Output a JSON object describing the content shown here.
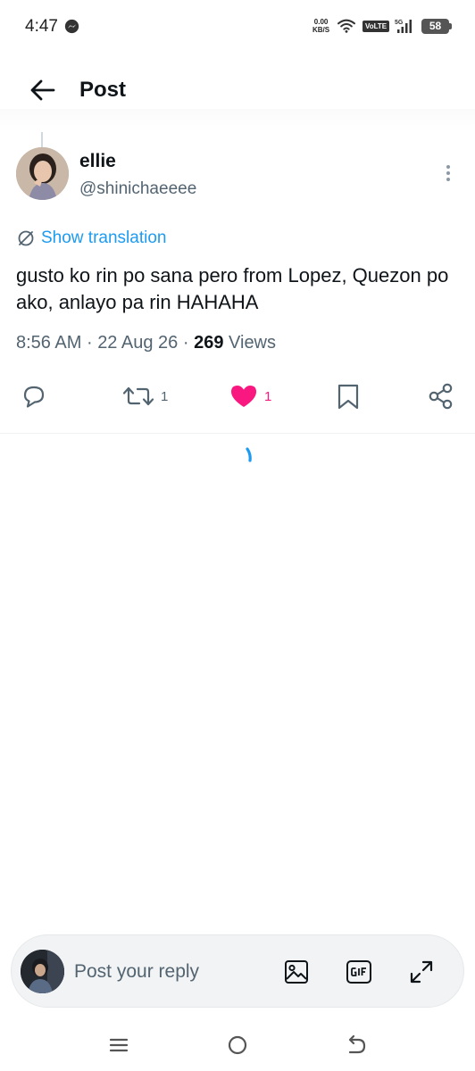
{
  "status_bar": {
    "time": "4:47",
    "net_speed_value": "0.00",
    "net_speed_unit": "KB/S",
    "volte": "VoLTE",
    "network": "5G",
    "battery": "58"
  },
  "header": {
    "title": "Post"
  },
  "post": {
    "author_name": "ellie",
    "author_handle": "@shinichaeeee",
    "translation_label": "Show translation",
    "text": "gusto ko rin po sana pero from Lopez, Quezon po ako, anlayo pa rin HAHAHA",
    "time": "8:56 AM",
    "date": "22 Aug 26",
    "views_count": "269",
    "views_label": "Views",
    "separator": "·"
  },
  "actions": {
    "reply_count": "",
    "repost_count": "1",
    "like_count": "1",
    "liked": true
  },
  "reply_bar": {
    "placeholder": "Post your reply",
    "tools": [
      "image-icon",
      "gif-icon",
      "expand-icon"
    ]
  },
  "colors": {
    "accent": "#1d9bf0",
    "like": "#f91880",
    "secondary_text": "#536471",
    "primary_text": "#0f1419"
  },
  "icons": {
    "back": "arrow-left-icon",
    "more": "more-vertical-icon",
    "translate": "translate-icon",
    "reply": "reply-icon",
    "repost": "repost-icon",
    "like": "heart-icon",
    "bookmark": "bookmark-icon",
    "share": "share-icon",
    "nav_menu": "menu-icon",
    "nav_home": "home-circle-icon",
    "nav_back": "back-icon"
  }
}
